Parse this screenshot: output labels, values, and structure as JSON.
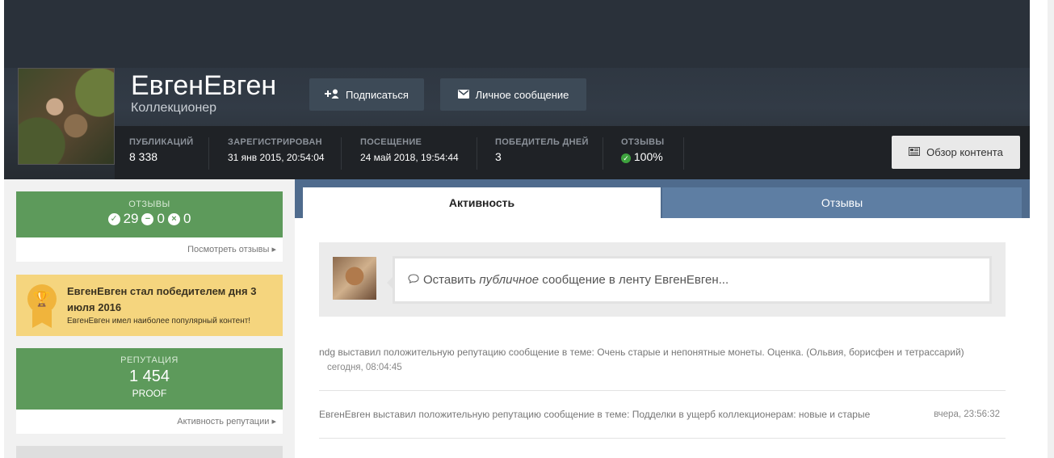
{
  "profile": {
    "name": "ЕвгенЕвген",
    "title": "Коллекционер",
    "follow_label": "Подписаться",
    "message_label": "Личное сообщение",
    "content_overview_label": "Обзор контента"
  },
  "stats": [
    {
      "label": "ПУБЛИКАЦИЙ",
      "value": "8 338"
    },
    {
      "label": "ЗАРЕГИСТРИРОВАН",
      "value": "31 янв 2015, 20:54:04"
    },
    {
      "label": "ПОСЕЩЕНИЕ",
      "value": "24 май 2018, 19:54:44"
    },
    {
      "label": "ПОБЕДИТЕЛЬ ДНЕЙ",
      "value": "3"
    },
    {
      "label": "ОТЗЫВЫ",
      "value": "100%"
    }
  ],
  "sidebar": {
    "feedback": {
      "label": "ОТЗЫВЫ",
      "positive": "29",
      "neutral": "0",
      "negative": "0",
      "link": "Посмотреть отзывы"
    },
    "winner": {
      "title": "ЕвгенЕвген стал победителем дня 3 июля 2016",
      "subtitle": "ЕвгенЕвген имел наиболее популярный контент!"
    },
    "reputation": {
      "label": "РЕПУТАЦИЯ",
      "value": "1 454",
      "rank": "PROOF",
      "link": "Активность репутации"
    }
  },
  "tabs": [
    {
      "label": "Активность",
      "active": true
    },
    {
      "label": "Отзывы",
      "active": false
    }
  ],
  "composer": {
    "before": "Оставить ",
    "emphasis": "публичное",
    "after": " сообщение в ленту ЕвгенЕвген..."
  },
  "feed": [
    {
      "text": "ndg выставил положительную репутацию сообщение в теме: Очень старые и непонятные монеты. Оценка. (Ольвия, борисфен и тетрассарий)",
      "time": "сегодня, 08:04:45"
    },
    {
      "text": "ЕвгенЕвген выставил положительную репутацию сообщение в теме: Подделки в ущерб коллекционерам: новые и старые",
      "time": "вчера, 23:56:32"
    }
  ],
  "colors": {
    "green": "#5d9a5b",
    "gold": "#f5d57e",
    "tab_blue": "#4f6b8d",
    "dark": "#1f2226"
  }
}
